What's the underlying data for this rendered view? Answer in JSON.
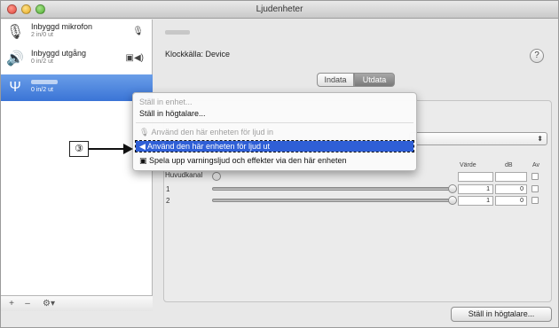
{
  "window": {
    "title": "Ljudenheter"
  },
  "sidebar": {
    "devices": [
      {
        "name": "Inbyggd mikrofon",
        "sub": "2 in/0 ut",
        "icon": "microphone-icon",
        "right_icon": "microphone-indicator-icon"
      },
      {
        "name": "Inbyggd utgång",
        "sub": "0 in/2 ut",
        "icon": "speaker-icon",
        "right_icon": "speaker-indicator-icon"
      },
      {
        "name": "",
        "sub": "0 in/2 ut",
        "icon": "usb-icon",
        "selected": true
      }
    ],
    "footer": {
      "add_label": "+",
      "remove_label": "–",
      "gear_label": "⚙▾"
    }
  },
  "main": {
    "clock_source": "Klockkälla: Device",
    "help_label": "?",
    "tabs": [
      {
        "label": "Indata"
      },
      {
        "label": "Utdata",
        "selected": true
      }
    ],
    "columns": {
      "value": "Värde",
      "db": "dB",
      "mute": "Av"
    },
    "channels": {
      "master": {
        "label": "Huvudkanal"
      },
      "rows": [
        {
          "label": "1",
          "value": "1",
          "db": "0"
        },
        {
          "label": "2",
          "value": "1",
          "db": "0"
        }
      ]
    },
    "setup_speakers_button": "Ställ in högtalare..."
  },
  "context_menu": {
    "items": [
      {
        "label": "Ställ in enhet...",
        "disabled": true
      },
      {
        "label": "Ställ in högtalare..."
      },
      {
        "label": "Använd den här enheten för ljud in",
        "disabled": true,
        "icon": "microphone-icon"
      },
      {
        "label": "Använd den här enheten för ljud ut",
        "selected": true,
        "icon": "speaker-icon"
      },
      {
        "label": "Spela upp varningsljud och effekter via den här enheten",
        "icon": "alert-speaker-icon"
      }
    ]
  },
  "annotation": {
    "label": "③"
  },
  "colors": {
    "selection_blue": "#2f5fd6",
    "sidebar_selected": "#3a74d6"
  }
}
